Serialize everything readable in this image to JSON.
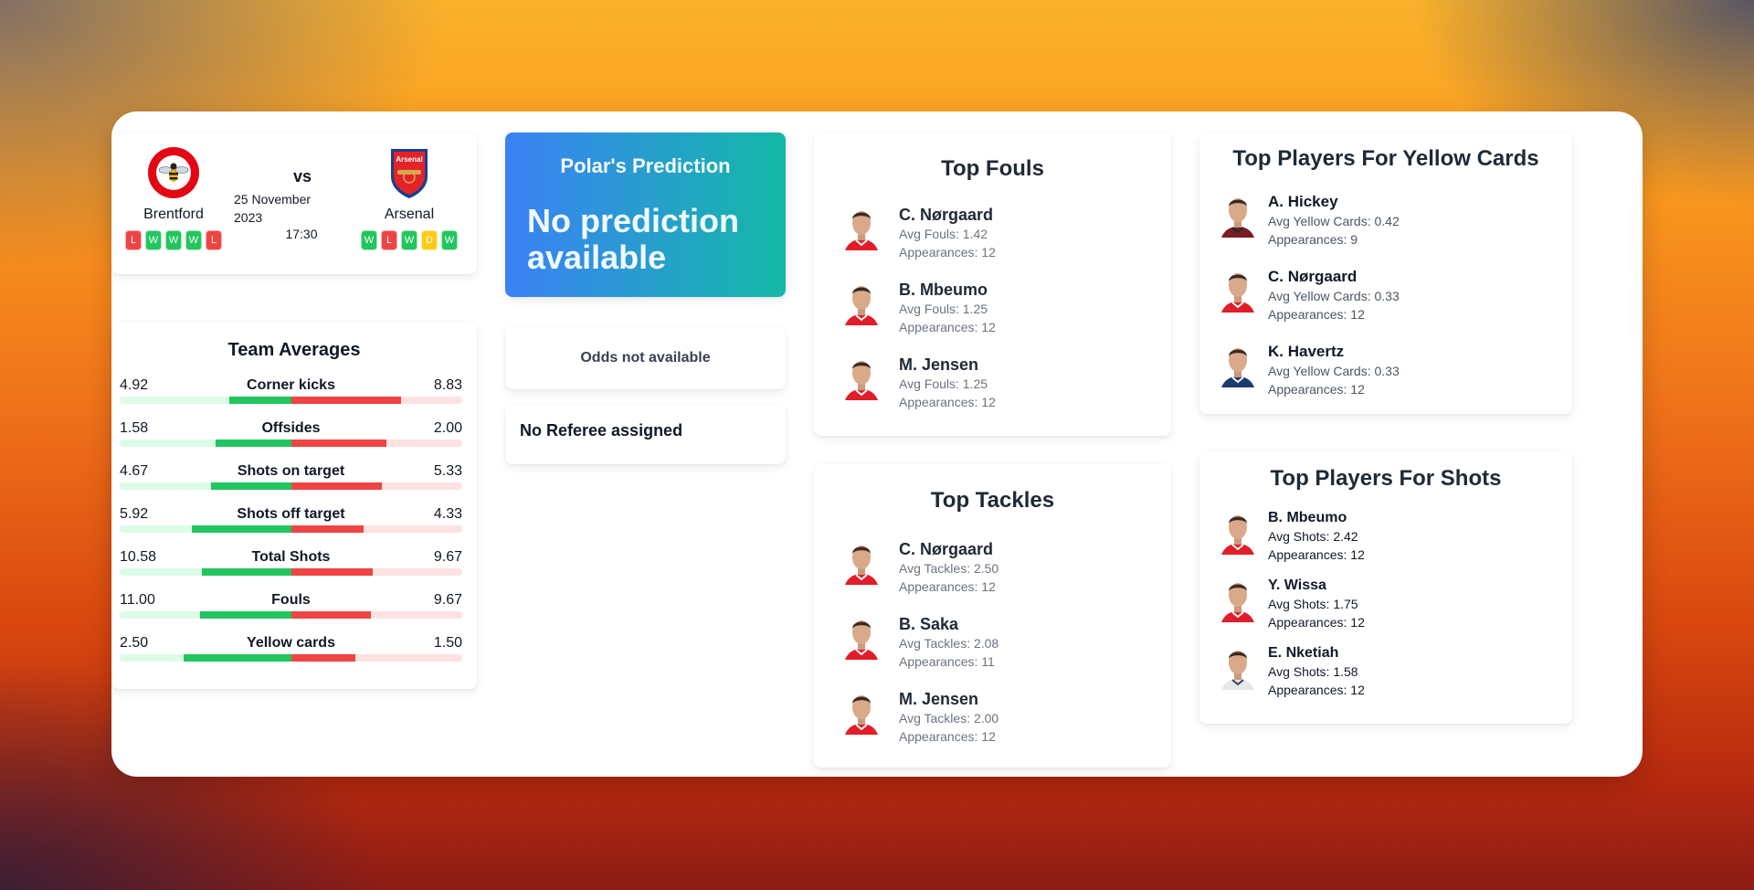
{
  "match": {
    "home": {
      "name": "Brentford",
      "crest": "brentford-crest",
      "form": [
        "L",
        "W",
        "W",
        "W",
        "L"
      ]
    },
    "away": {
      "name": "Arsenal",
      "crest": "arsenal-crest",
      "form": [
        "W",
        "L",
        "W",
        "D",
        "W"
      ]
    },
    "vs_label": "vs",
    "date": "25 November 2023",
    "time": "17:30"
  },
  "team_averages": {
    "title": "Team Averages",
    "stats": [
      {
        "label": "Corner kicks",
        "home": "4.92",
        "away": "8.83"
      },
      {
        "label": "Offsides",
        "home": "1.58",
        "away": "2.00"
      },
      {
        "label": "Shots on target",
        "home": "4.67",
        "away": "5.33"
      },
      {
        "label": "Shots off target",
        "home": "5.92",
        "away": "4.33"
      },
      {
        "label": "Total Shots",
        "home": "10.58",
        "away": "9.67"
      },
      {
        "label": "Fouls",
        "home": "11.00",
        "away": "9.67"
      },
      {
        "label": "Yellow cards",
        "home": "2.50",
        "away": "1.50"
      }
    ],
    "colors": {
      "home_fill": "#22c55e",
      "home_track": "#dcfce7",
      "away_fill": "#ef4444",
      "away_track": "#fee2e2"
    }
  },
  "prediction": {
    "title": "Polar's Prediction",
    "value": "No prediction available"
  },
  "odds": {
    "text": "Odds not available"
  },
  "referee": {
    "text": "No Referee assigned"
  },
  "top_fouls": {
    "title": "Top Fouls",
    "players": [
      {
        "name": "C. Nørgaard",
        "stat": "Avg Fouls: 1.42",
        "appearances": "Appearances: 12",
        "kit": "red"
      },
      {
        "name": "B. Mbeumo",
        "stat": "Avg Fouls: 1.25",
        "appearances": "Appearances: 12",
        "kit": "red"
      },
      {
        "name": "M. Jensen",
        "stat": "Avg Fouls: 1.25",
        "appearances": "Appearances: 12",
        "kit": "red"
      }
    ]
  },
  "top_tackles": {
    "title": "Top Tackles",
    "players": [
      {
        "name": "C. Nørgaard",
        "stat": "Avg Tackles: 2.50",
        "appearances": "Appearances: 12",
        "kit": "red"
      },
      {
        "name": "B. Saka",
        "stat": "Avg Tackles: 2.08",
        "appearances": "Appearances: 11",
        "kit": "red"
      },
      {
        "name": "M. Jensen",
        "stat": "Avg Tackles: 2.00",
        "appearances": "Appearances: 12",
        "kit": "red"
      }
    ]
  },
  "top_yellow_cards": {
    "title": "Top Players For Yellow Cards",
    "players": [
      {
        "name": "A. Hickey",
        "stat": "Avg Yellow Cards: 0.42",
        "appearances": "Appearances: 9",
        "kit": "dark"
      },
      {
        "name": "C. Nørgaard",
        "stat": "Avg Yellow Cards: 0.33",
        "appearances": "Appearances: 12",
        "kit": "red"
      },
      {
        "name": "K. Havertz",
        "stat": "Avg Yellow Cards: 0.33",
        "appearances": "Appearances: 12",
        "kit": "navy"
      }
    ]
  },
  "top_shots": {
    "title": "Top Players For Shots",
    "players": [
      {
        "name": "B. Mbeumo",
        "stat": "Avg Shots: 2.42",
        "appearances": "Appearances: 12",
        "kit": "red"
      },
      {
        "name": "Y. Wissa",
        "stat": "Avg Shots: 1.75",
        "appearances": "Appearances: 12",
        "kit": "red"
      },
      {
        "name": "E. Nketiah",
        "stat": "Avg Shots: 1.58",
        "appearances": "Appearances: 12",
        "kit": "white"
      }
    ]
  }
}
